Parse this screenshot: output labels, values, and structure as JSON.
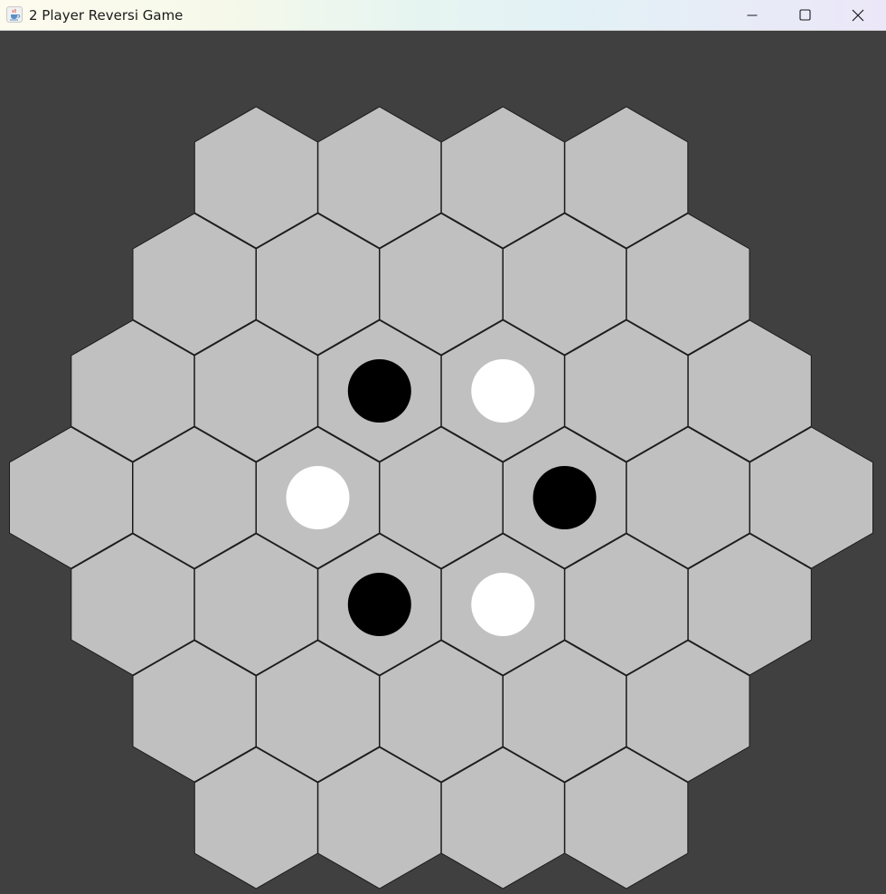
{
  "window": {
    "title": "2 Player Reversi Game",
    "icon": "java-coffee-cup-icon",
    "controls": [
      {
        "name": "minimize-button",
        "icon": "minimize-icon"
      },
      {
        "name": "maximize-button",
        "icon": "maximize-icon"
      },
      {
        "name": "close-button",
        "icon": "close-icon"
      }
    ]
  },
  "colors": {
    "background": "#404040",
    "cell": "#c0c0c0",
    "cell_border": "#1a1a1a",
    "black_disc": "#000000",
    "white_disc": "#ffffff"
  },
  "board": {
    "shape": "hexagon",
    "side_length": 4,
    "rows": [
      {
        "cells": [
          null,
          null,
          null,
          null
        ]
      },
      {
        "cells": [
          null,
          null,
          null,
          null,
          null
        ]
      },
      {
        "cells": [
          null,
          null,
          "black",
          "white",
          null,
          null
        ]
      },
      {
        "cells": [
          null,
          null,
          "white",
          null,
          "black",
          null,
          null
        ]
      },
      {
        "cells": [
          null,
          null,
          "black",
          "white",
          null,
          null
        ]
      },
      {
        "cells": [
          null,
          null,
          null,
          null,
          null
        ]
      },
      {
        "cells": [
          null,
          null,
          null,
          null
        ]
      }
    ]
  }
}
